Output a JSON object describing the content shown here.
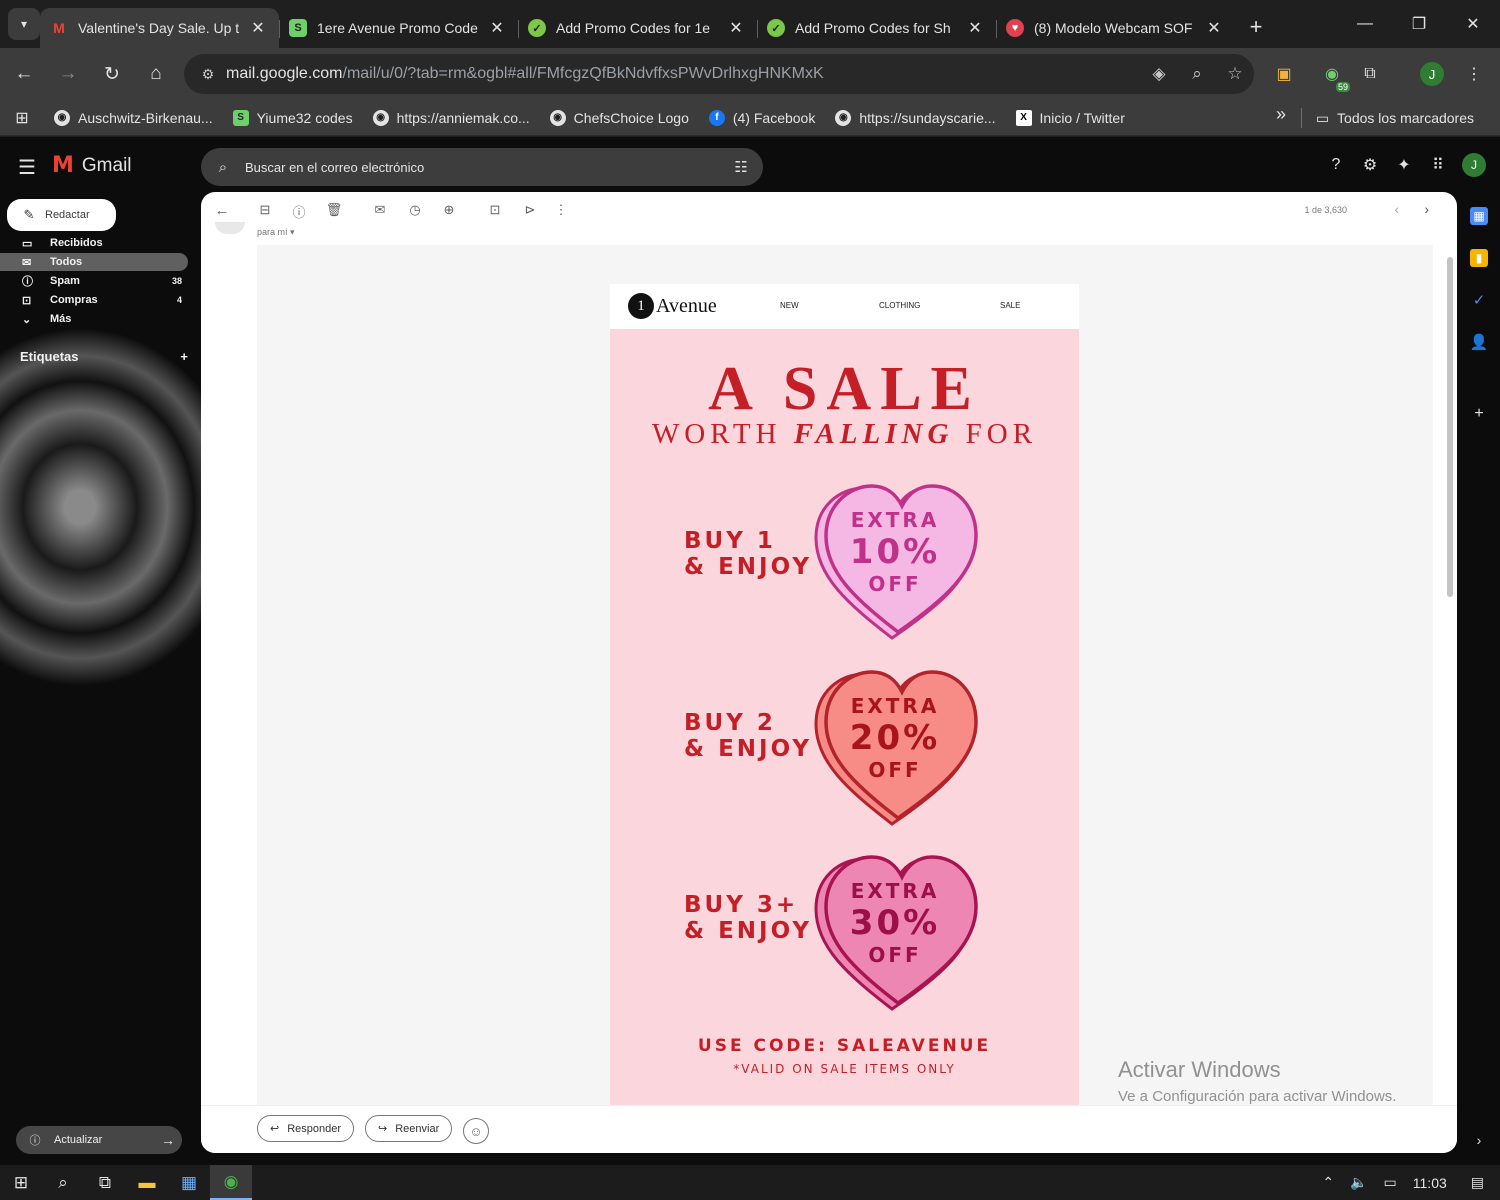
{
  "browser": {
    "tabs": [
      {
        "title": "Valentine's Day Sale. Up t",
        "icon": "gmail-icon",
        "active": true
      },
      {
        "title": "1ere Avenue Promo Code",
        "icon": "s-logo-icon",
        "active": false
      },
      {
        "title": "Add Promo Codes for 1e",
        "icon": "check-badge-icon",
        "active": false
      },
      {
        "title": "Add Promo Codes for Sh",
        "icon": "check-badge-icon",
        "active": false
      },
      {
        "title": "(8) Modelo Webcam SOF",
        "icon": "heart-logo-icon",
        "active": false
      }
    ],
    "new_tab": "+",
    "url_host": "mail.google.com",
    "url_path": "/mail/u/0/?tab=rm&ogbl#all/FMfcgzQfBkNdvffxsPWvDrlhxgHNKMxK",
    "profile_initial": "J",
    "extension_badge": "59",
    "bookmarks": [
      {
        "label": "Auschwitz-Birkenau...",
        "icon": "globe-icon"
      },
      {
        "label": "Yiume32 codes",
        "icon": "s-logo-icon"
      },
      {
        "label": "https://anniemak.co...",
        "icon": "globe-icon"
      },
      {
        "label": "ChefsChoice Logo",
        "icon": "globe-icon"
      },
      {
        "label": "(4) Facebook",
        "icon": "facebook-icon"
      },
      {
        "label": "https://sundayscarie...",
        "icon": "globe-icon"
      },
      {
        "label": "Inicio / Twitter",
        "icon": "x-logo-icon"
      }
    ],
    "bookmarks_more": "»",
    "all_bookmarks": "Todos los marcadores"
  },
  "gmail": {
    "app_name": "Gmail",
    "search_placeholder": "Buscar en el correo electrónico",
    "avatar_initial": "J",
    "compose_label": "Redactar",
    "nav": [
      {
        "label": "Recibidos",
        "count": "",
        "icon": "inbox-icon",
        "selected": false
      },
      {
        "label": "Todos",
        "count": "",
        "icon": "all-mail-icon",
        "selected": true
      },
      {
        "label": "Spam",
        "count": "38",
        "icon": "spam-icon",
        "selected": false
      },
      {
        "label": "Compras",
        "count": "4",
        "icon": "shopping-icon",
        "selected": false
      },
      {
        "label": "Más",
        "count": "",
        "icon": "chevron-down-icon",
        "selected": false
      }
    ],
    "labels_heading": "Etiquetas",
    "update_label": "Actualizar",
    "pager_text": "1 de 3,630",
    "recipient_text": "para mí ▾",
    "reply_label": "Responder",
    "forward_label": "Reenviar"
  },
  "newsletter": {
    "logo_number": "1",
    "logo_text": "Avenue",
    "nav": [
      "NEW",
      "CLOTHING",
      "SALE"
    ],
    "headline": "A SALE",
    "subhead_before": "WORTH ",
    "subhead_em": "FALLING",
    "subhead_after": " FOR",
    "offers": [
      {
        "line1": "BUY 1",
        "line2": "& ENJOY",
        "extra": "EXTRA",
        "percent": "10%",
        "off": "OFF",
        "fill": "#f5b8e4",
        "stroke": "#c0328a",
        "text_color": "#c0328a"
      },
      {
        "line1": "BUY 2",
        "line2": "& ENJOY",
        "extra": "EXTRA",
        "percent": "20%",
        "off": "OFF",
        "fill": "#f78c86",
        "stroke": "#b3232b",
        "text_color": "#a8141c"
      },
      {
        "line1": "BUY 3+",
        "line2": "& ENJOY",
        "extra": "EXTRA",
        "percent": "30%",
        "off": "OFF",
        "fill": "#ee86b4",
        "stroke": "#a8144f",
        "text_color": "#9c0f48"
      }
    ],
    "code_text": "USE CODE: SALEAVENUE",
    "valid_text": "*VALID ON SALE ITEMS ONLY",
    "accent_color": "#c41f26",
    "background_color": "#fcd6dd"
  },
  "watermark": {
    "title": "Activar Windows",
    "subtitle": "Ve a Configuración para activar Windows."
  },
  "taskbar": {
    "time": "11:03"
  }
}
